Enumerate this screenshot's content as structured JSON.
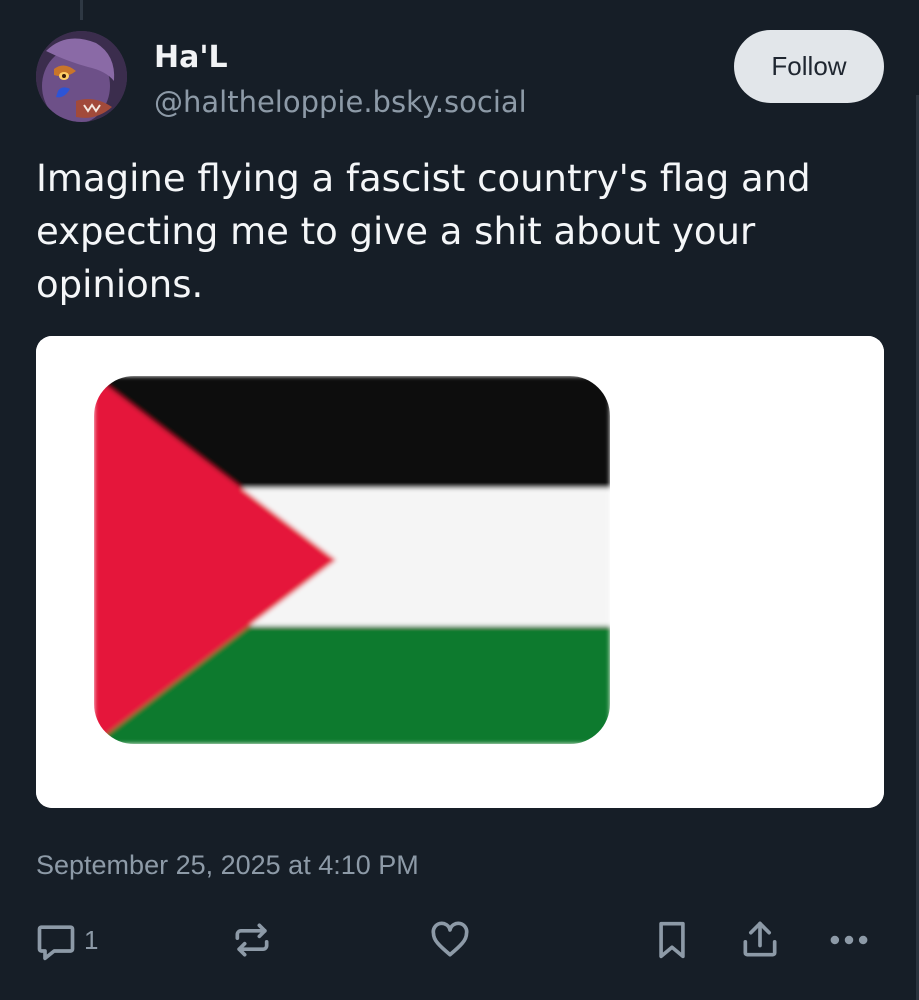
{
  "post": {
    "author": {
      "display_name": "Ha'L",
      "handle": "@haltheloppie.bsky.social"
    },
    "follow_label": "Follow",
    "text": "Imagine flying a fascist country's flag and expecting me to give a shit about your opinions.",
    "image": {
      "subject": "palestine-flag-emoji",
      "colors": {
        "black": "#111111",
        "white": "#f5f5f5",
        "green": "#0c7a2e",
        "red": "#e5173a"
      }
    },
    "timestamp": "September 25, 2025 at 4:10 PM",
    "actions": {
      "reply_count": "1",
      "icons": [
        "reply-icon",
        "repost-icon",
        "like-icon",
        "bookmark-icon",
        "share-icon",
        "more-icon"
      ]
    }
  },
  "colors": {
    "background": "#161e27",
    "muted_text": "#8d9aa7",
    "primary_text": "#f1f3f5",
    "follow_button_bg": "#e2e6ea"
  }
}
